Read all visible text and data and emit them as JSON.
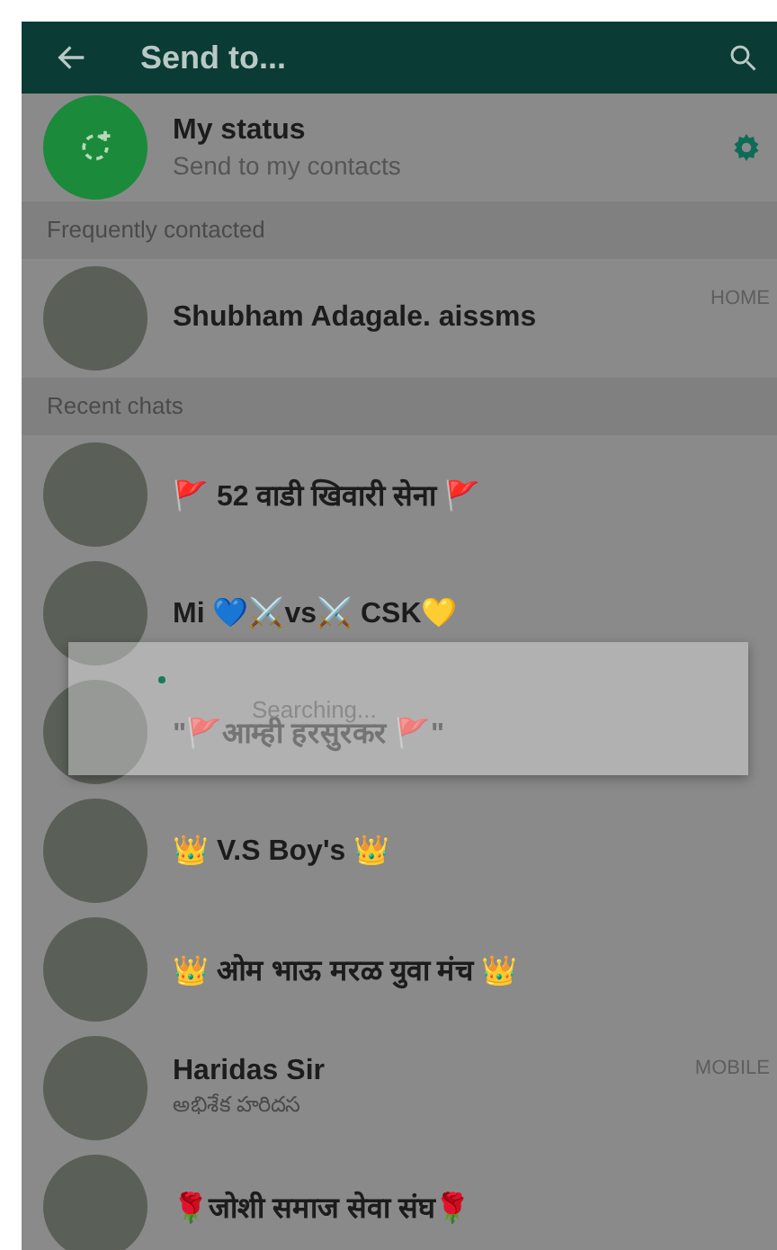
{
  "app_bar": {
    "title": "Send to..."
  },
  "my_status": {
    "title": "My status",
    "subtitle": "Send to my contacts"
  },
  "sections": [
    {
      "header": "Frequently contacted",
      "contacts": [
        {
          "name": "Shubham Adagale. aissms",
          "label": "HOME"
        }
      ]
    },
    {
      "header": "Recent chats",
      "contacts": [
        {
          "name": "🚩 52 वाडी खिवारी सेना 🚩"
        },
        {
          "name": "Mi 💙⚔️vs⚔️ CSK💛"
        },
        {
          "name": "\"🚩आम्ही हरसुरकर 🚩\""
        },
        {
          "name": "👑 V.S Boy's 👑"
        },
        {
          "name": "👑 ओम भाऊ मरळ युवा मंच 👑"
        },
        {
          "name": "Haridas Sir",
          "subtitle": "అభిశేక హరిదస",
          "label": "MOBILE"
        },
        {
          "name": "🌹जोशी समाज सेवा संघ🌹"
        }
      ]
    }
  ],
  "dialog": {
    "message": "Searching..."
  }
}
